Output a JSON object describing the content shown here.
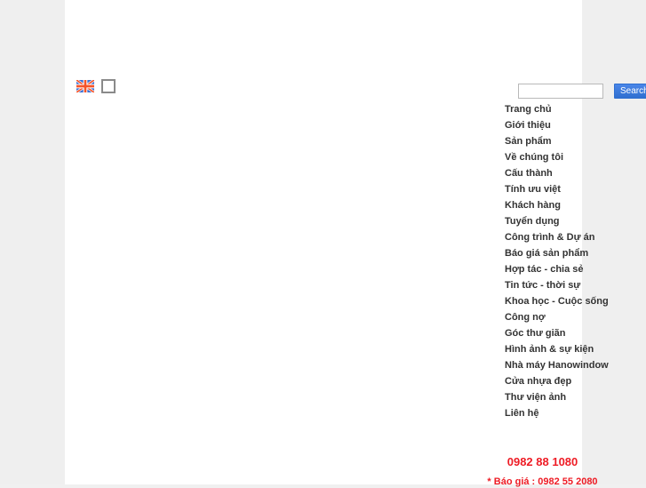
{
  "page": {
    "background_color": "#efefef",
    "content_background_color": "#ffffff"
  },
  "language_bar": {
    "flag_icon": "uk-flag-icon",
    "flag_alt": "English",
    "broken_image_alt": ""
  },
  "search": {
    "value": "",
    "placeholder": "",
    "button_label": "Search",
    "button_color": "#3b7ce8"
  },
  "nav": {
    "items": [
      {
        "label": "Trang chủ"
      },
      {
        "label": "Giới thiệu"
      },
      {
        "label": "Sản phẩm"
      },
      {
        "label": "Về chúng tôi"
      },
      {
        "label": "Cấu thành"
      },
      {
        "label": "Tính ưu việt"
      },
      {
        "label": "Khách hàng"
      },
      {
        "label": "Tuyển dụng"
      },
      {
        "label": "Công trình & Dự án"
      },
      {
        "label": "Báo giá sản phẩm"
      },
      {
        "label": "Hợp tác - chia sẻ"
      },
      {
        "label": "Tin tức - thời sự"
      },
      {
        "label": "Khoa học - Cuộc sống"
      },
      {
        "label": "Công nợ"
      },
      {
        "label": "Góc thư giãn"
      },
      {
        "label": "Hình ảnh & sự kiện"
      },
      {
        "label": "Nhà máy Hanowindow"
      },
      {
        "label": "Cửa nhựa đẹp"
      },
      {
        "label": "Thư viện ảnh"
      },
      {
        "label": "Liên hệ"
      }
    ]
  },
  "hotline": {
    "number": "0982 88 1080",
    "quote_line": "* Báo giá : 0982 55 2080",
    "color": "#ee1c25"
  }
}
